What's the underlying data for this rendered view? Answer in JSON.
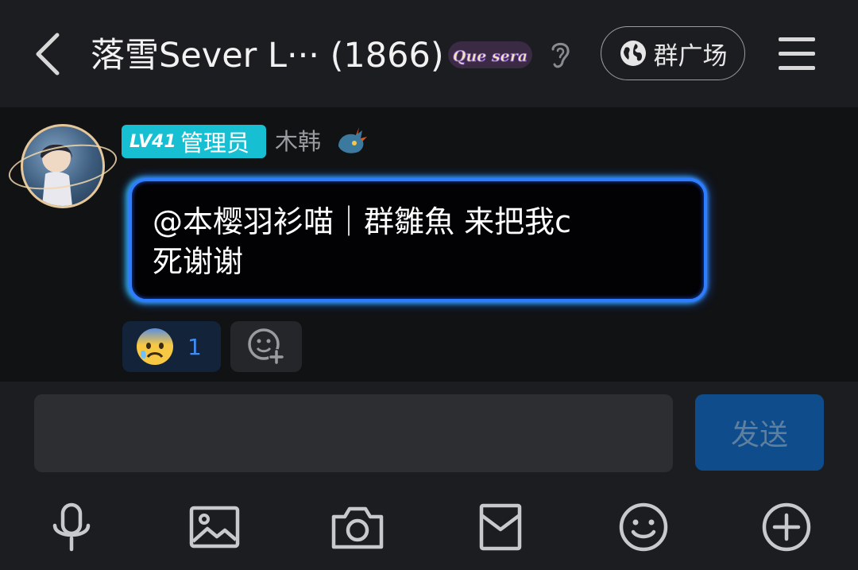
{
  "header": {
    "title": "落雪Sever L··· (1866)",
    "badge_text": "Que sera",
    "plaza_label": "群广场"
  },
  "message": {
    "level": "LV41",
    "role": "管理员",
    "sender": "木韩",
    "text_line1": "@本樱羽衫喵｜群雛魚 来把我c",
    "text_line2": "死谢谢",
    "reaction": {
      "emoji": "anxious-face-with-sweat",
      "count": "1"
    }
  },
  "composer": {
    "placeholder": "",
    "send_label": "发送"
  },
  "toolbar": [
    "microphone-icon",
    "image-icon",
    "camera-icon",
    "red-packet-icon",
    "emoji-icon",
    "plus-icon"
  ],
  "colors": {
    "header_bg": "#1c1d21",
    "chat_bg": "#111214",
    "badge_bg": "#17bfd3",
    "bubble_border": "#2f7dff",
    "send_bg": "#0f4c8c",
    "reaction_count": "#3d8df5"
  }
}
